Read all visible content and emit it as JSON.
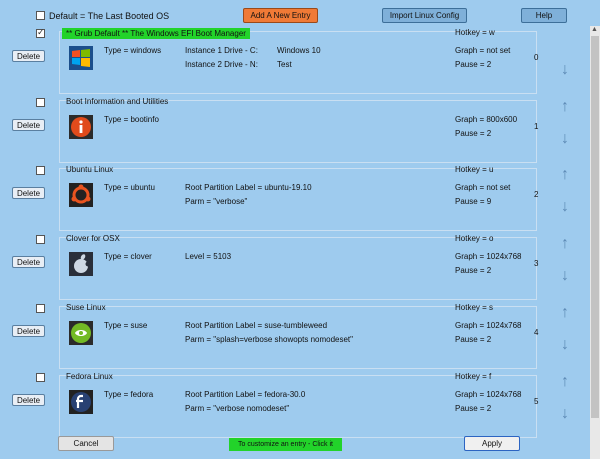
{
  "header": {
    "default_label": "Default = The Last Booted OS",
    "add_label": "Add A New Entry",
    "import_label": "Import Linux Config",
    "help_label": "Help"
  },
  "delete_label": "Delete",
  "entries": [
    {
      "name": "** Grub Default **        The Windows EFI Boot Manager",
      "type": "Type = windows",
      "col2a": "Instance 1    Drive - C:",
      "col2b": "Instance 2    Drive - N:",
      "col3a": "Windows 10",
      "col3b": "Test",
      "hotkey": "Hotkey = w",
      "graph": "Graph = not set",
      "pause": "Pause = 2",
      "index": "0",
      "icon": "windows-icon"
    },
    {
      "name": "Boot Information and Utilities",
      "type": "Type = bootinfo",
      "col2a": "",
      "col2b": "",
      "hotkey": "",
      "graph": "Graph = 800x600",
      "pause": "Pause = 2",
      "index": "1",
      "icon": "info-icon"
    },
    {
      "name": "Ubuntu Linux",
      "type": "Type = ubuntu",
      "col2a": "Root Partition Label = ubuntu-19.10",
      "col2b": "Parm  =   \"verbose\"",
      "hotkey": "Hotkey = u",
      "graph": "Graph = not set",
      "pause": "Pause = 9",
      "index": "2",
      "icon": "ubuntu-icon"
    },
    {
      "name": "Clover for OSX",
      "type": "Type = clover",
      "col2a": "Level = 5103",
      "col2b": "",
      "hotkey": "Hotkey = o",
      "graph": "Graph = 1024x768",
      "pause": "Pause = 2",
      "index": "3",
      "icon": "apple-icon"
    },
    {
      "name": "Suse Linux",
      "type": "Type = suse",
      "col2a": "Root Partition Label = suse-tumbleweed",
      "col2b": "Parm  =   \"splash=verbose showopts nomodeset\"",
      "hotkey": "Hotkey = s",
      "graph": "Graph = 1024x768",
      "pause": "Pause = 2",
      "index": "4",
      "icon": "suse-icon"
    },
    {
      "name": "Fedora Linux",
      "type": "Type = fedora",
      "col2a": "Root Partition Label = fedora-30.0",
      "col2b": "Parm  =   \"verbose nomodeset\"",
      "hotkey": "Hotkey = f",
      "graph": "Graph = 1024x768",
      "pause": "Pause = 2",
      "index": "5",
      "icon": "fedora-icon"
    }
  ],
  "footer": {
    "cancel_label": "Cancel",
    "status_text": "To customize an entry - Click it",
    "apply_label": "Apply"
  },
  "colors": {
    "background": "#9ecbee",
    "add_button": "#f07a36",
    "status_green": "#22d32a"
  }
}
